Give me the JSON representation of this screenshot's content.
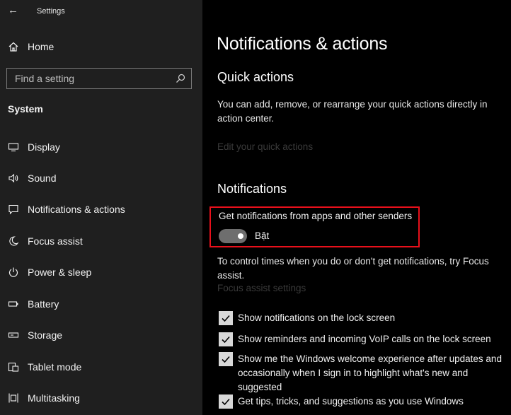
{
  "window": {
    "title": "Settings"
  },
  "sidebar": {
    "home_label": "Home",
    "search_placeholder": "Find a setting",
    "section_title": "System",
    "items": [
      {
        "label": "Display",
        "icon": "monitor-icon"
      },
      {
        "label": "Sound",
        "icon": "speaker-icon"
      },
      {
        "label": "Notifications & actions",
        "icon": "notification-icon"
      },
      {
        "label": "Focus assist",
        "icon": "moon-icon"
      },
      {
        "label": "Power & sleep",
        "icon": "power-icon"
      },
      {
        "label": "Battery",
        "icon": "battery-icon"
      },
      {
        "label": "Storage",
        "icon": "storage-icon"
      },
      {
        "label": "Tablet mode",
        "icon": "tablet-mode-icon"
      },
      {
        "label": "Multitasking",
        "icon": "multitasking-icon"
      }
    ]
  },
  "main": {
    "title": "Notifications & actions",
    "quick_actions": {
      "heading": "Quick actions",
      "description": "You can add, remove, or rearrange your quick actions directly in action center.",
      "link": "Edit your quick actions"
    },
    "notifications": {
      "heading": "Notifications",
      "toggle_label": "Get notifications from apps and other senders",
      "toggle_state": "Bật",
      "toggle_on": true,
      "focus_text": "To control times when you do or don't get notifications, try Focus assist.",
      "focus_link": "Focus assist settings",
      "checkboxes": [
        {
          "label": "Show notifications on the lock screen",
          "checked": true
        },
        {
          "label": "Show reminders and incoming VoIP calls on the lock screen",
          "checked": true
        },
        {
          "label": "Show me the Windows welcome experience after updates and occasionally when I sign in to highlight what's new and suggested",
          "checked": true
        },
        {
          "label": "Get tips, tricks, and suggestions as you use Windows",
          "checked": true
        }
      ]
    }
  },
  "colors": {
    "sidebar_bg": "#1f1f1f",
    "main_bg": "#000000",
    "highlight_border": "#e8101b",
    "checkbox_fill": "#d8d8d8"
  }
}
